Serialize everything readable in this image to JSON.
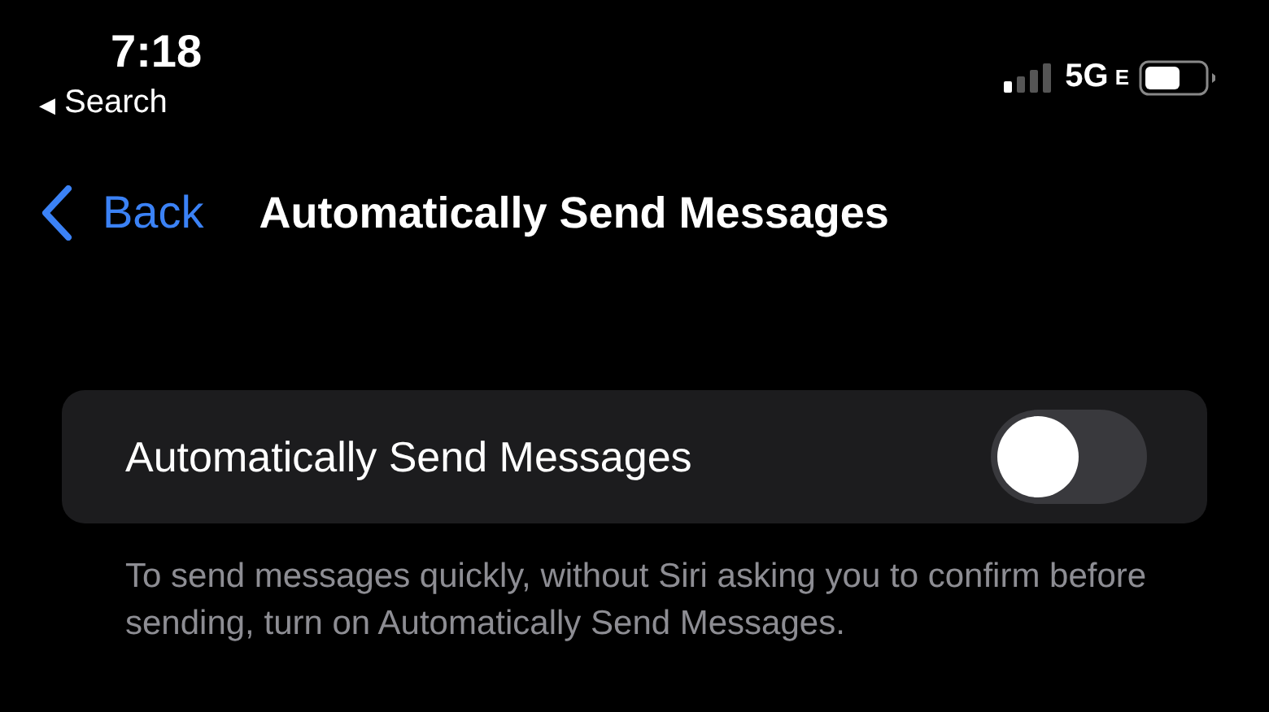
{
  "status_bar": {
    "time": "7:18",
    "back_app": {
      "arrow": "◀",
      "label": "Search"
    },
    "network": "5G",
    "network_suffix": "E"
  },
  "nav": {
    "back_label": "Back",
    "title": "Automatically Send Messages"
  },
  "settings": [
    {
      "label": "Automatically Send Messages",
      "on": false
    }
  ],
  "footer": "To send messages quickly, without Siri asking you to confirm before sending, turn on Automatically Send Messages."
}
